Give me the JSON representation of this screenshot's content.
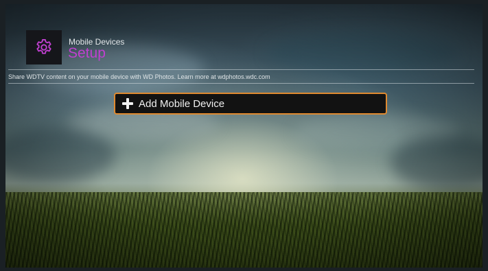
{
  "header": {
    "section_label": "Mobile Devices",
    "title": "Setup",
    "icon": "gear-icon",
    "title_color": "#c040d0"
  },
  "description": "Share WDTV content on your mobile device with WD Photos. Learn more at wdphotos.wdc.com",
  "actions": {
    "add_label": "Add Mobile Device",
    "add_icon": "plus-icon",
    "focus_color": "#e08a30"
  }
}
